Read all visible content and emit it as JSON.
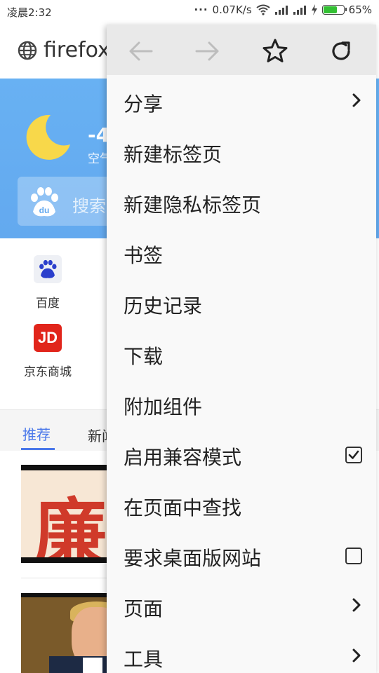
{
  "status_bar": {
    "time": "凌晨2:32",
    "speed": "0.07K/s",
    "battery": "65%",
    "battery_level": 0.65
  },
  "toolbar": {
    "brand": "firefox"
  },
  "weather": {
    "temp": "-4",
    "air_quality": "空气"
  },
  "search": {
    "placeholder": "搜索"
  },
  "quick_links": [
    {
      "label": "百度",
      "icon": "baidu-icon"
    },
    {
      "label": "京东商城",
      "icon": "jd-icon"
    }
  ],
  "feed_tabs": [
    {
      "label": "推荐",
      "active": true
    },
    {
      "label": "新闻",
      "active": false
    }
  ],
  "feed_image_text": "廉",
  "menu": {
    "nav": [
      {
        "name": "back",
        "icon": "arrow-left-icon",
        "enabled": false
      },
      {
        "name": "forward",
        "icon": "arrow-right-icon",
        "enabled": false
      },
      {
        "name": "bookmark",
        "icon": "star-icon",
        "enabled": true
      },
      {
        "name": "reload",
        "icon": "reload-icon",
        "enabled": true
      }
    ],
    "items": [
      {
        "label": "分享",
        "trailing": "chevron"
      },
      {
        "label": "新建标签页",
        "trailing": "none"
      },
      {
        "label": "新建隐私标签页",
        "trailing": "none"
      },
      {
        "label": "书签",
        "trailing": "none"
      },
      {
        "label": "历史记录",
        "trailing": "none"
      },
      {
        "label": "下载",
        "trailing": "none"
      },
      {
        "label": "附加组件",
        "trailing": "none"
      },
      {
        "label": "启用兼容模式",
        "trailing": "checkbox",
        "checked": true
      },
      {
        "label": "在页面中查找",
        "trailing": "none"
      },
      {
        "label": "要求桌面版网站",
        "trailing": "checkbox",
        "checked": false
      },
      {
        "label": "页面",
        "trailing": "chevron"
      },
      {
        "label": "工具",
        "trailing": "chevron"
      }
    ]
  },
  "colors": {
    "accent": "#4a78ea",
    "header": "#68b1f3",
    "menu_bg": "#f9f9f9",
    "menu_top": "#e9e9e9"
  }
}
